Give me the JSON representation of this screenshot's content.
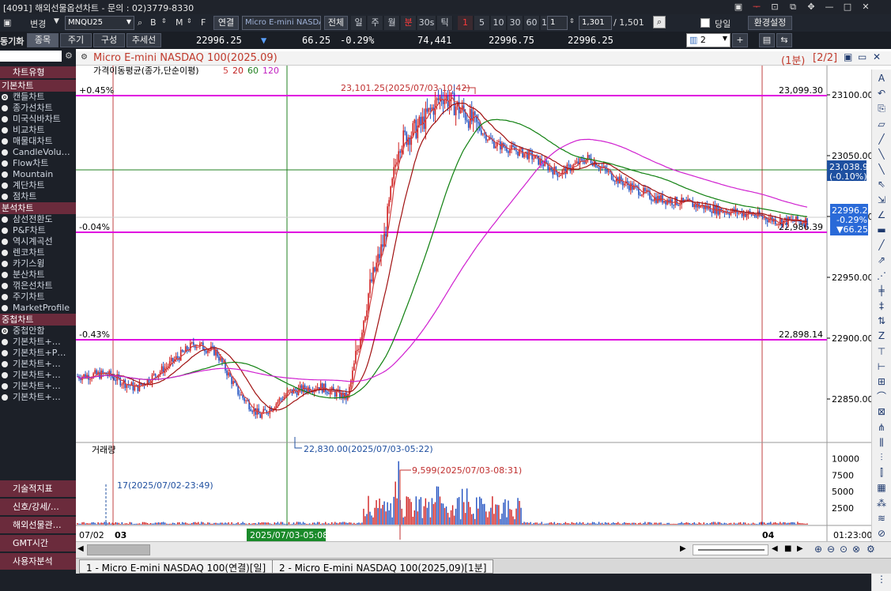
{
  "titlebar": {
    "title": "[4091] 해외선물옵션차트 - 문의 : 02)3779-8330",
    "buttons": [
      "▣",
      "ᅮ",
      "⊡",
      "⧉",
      "✥",
      "—",
      "□",
      "✕"
    ]
  },
  "toolbar1": {
    "change_label": "변경",
    "symbol_code": "MNQU25",
    "abc": [
      "B",
      "M",
      "F"
    ],
    "link_label": "연결",
    "symbol_name": "Micro E-mini NASDAQ",
    "all_label": "전체",
    "periods": [
      {
        "label": "일",
        "red": false
      },
      {
        "label": "주",
        "red": false
      },
      {
        "label": "월",
        "red": false
      },
      {
        "label": "분",
        "red": true
      },
      {
        "label": "30s",
        "red": false
      },
      {
        "label": "틱",
        "red": false
      },
      {
        "label": "1",
        "red": true
      },
      {
        "label": "5",
        "red": false
      },
      {
        "label": "10",
        "red": false
      },
      {
        "label": "30",
        "red": false
      },
      {
        "label": "60",
        "red": false
      },
      {
        "label": "120",
        "red": false
      }
    ],
    "interval_value": "1",
    "count_value": "1,301",
    "total_count": "/ 1,501",
    "same_day_label": "당일",
    "settings_label": "환경설정"
  },
  "toolbar2": {
    "left_label": "동기화",
    "tabs": [
      "종목",
      "주기",
      "구성",
      "추세선"
    ],
    "price": "22996.25",
    "change_arrow": "▼",
    "change": "66.25",
    "change_pct": "-0.29%",
    "volume": "74,441",
    "ask": "22996.75",
    "bid": "22996.25",
    "layout_count": "2"
  },
  "sidebar": {
    "top_header": "차트유형",
    "sections": [
      {
        "title": "기본차트",
        "items": [
          "캔들차트",
          "종가선차트",
          "미국식바차트",
          "비교차트",
          "매물대차트",
          "CandleVolu…",
          "Flow차트",
          "Mountain",
          "계단차트",
          "점차트"
        ],
        "selected": 0
      },
      {
        "title": "분석차트",
        "items": [
          "삼선전환도",
          "P&F차트",
          "역시계곡선",
          "렌코차트",
          "카기스윙",
          "분산차트",
          "꺾은선차트",
          "주기차트",
          "MarketProfile"
        ],
        "selected": -1
      },
      {
        "title": "중첩차트",
        "items": [
          "중첩안함",
          "기본차트+…",
          "기본차트+P…",
          "기본차트+…",
          "기본차트+…",
          "기본차트+…",
          "기본차트+…"
        ],
        "selected": 0
      }
    ],
    "footer": [
      "기술적지표",
      "신호/강세/…",
      "해외선물관…",
      "GMT시간",
      "사용자분석"
    ]
  },
  "chart": {
    "title": "Micro E-mini NASDAQ 100(2025.09)",
    "period_label": "(1분)",
    "page_label": "[2/2]",
    "legend_label": "가격이동평균(종가,단순이평)",
    "ma_periods": [
      {
        "label": "5",
        "color": "#d04040"
      },
      {
        "label": "20",
        "color": "#c02020"
      },
      {
        "label": "60",
        "color": "#208020"
      },
      {
        "label": "120",
        "color": "#c020c0"
      }
    ],
    "ref_lines": [
      {
        "pct": "+0.45%",
        "value": "23,099.30",
        "price": 23099.3
      },
      {
        "pct": "-0.04%",
        "value": "22,986.39",
        "price": 22986.39
      },
      {
        "pct": "-0.43%",
        "value": "22,898.14",
        "price": 22898.14
      }
    ],
    "high_annotation": "23,101.25(2025/07/03-10:42)",
    "low_annotation": "22,830.00(2025/07/03-05:22)",
    "price_axis": [
      "23100.00",
      "23050.00",
      "23000.00",
      "22950.00",
      "22900.00",
      "22850.00"
    ],
    "crosshair_price": "23,038.95",
    "crosshair_pct": "(-0.10%)",
    "current_price": "22996.25",
    "current_pct": "-0.29%",
    "current_change": "▼66.25",
    "volume_label": "거래량",
    "volume_max_annotation": "9,599(2025/07/03-08:31)",
    "volume_min_annotation": "17(2025/07/02-23:49)",
    "volume_axis": [
      "10000",
      "7500",
      "5000",
      "2500"
    ],
    "time_labels": [
      "07/02",
      "03",
      "04"
    ],
    "crosshair_time": "2025/07/03-05:08",
    "last_time": "01:23:00",
    "colors": {
      "ref_line": "#e000e0",
      "up": "#d02020",
      "down": "#2050c0",
      "ma5": "#d04040",
      "ma20": "#a01010",
      "ma60": "#108010",
      "ma120": "#d020d0",
      "title_red": "#c0392b",
      "sidebar_head": "#6b2b3c"
    }
  },
  "chart_data": {
    "type": "candlestick",
    "title": "Micro E-mini NASDAQ 100(2025.09)",
    "xlabel": "",
    "ylabel": "",
    "ylim": [
      22800,
      23120
    ],
    "x_session_marks": [
      "07/02",
      "03",
      "04"
    ],
    "price_path": [
      [
        0,
        22868
      ],
      [
        0.04,
        22870
      ],
      [
        0.08,
        22858
      ],
      [
        0.12,
        22875
      ],
      [
        0.16,
        22895
      ],
      [
        0.19,
        22888
      ],
      [
        0.22,
        22855
      ],
      [
        0.25,
        22835
      ],
      [
        0.29,
        22855
      ],
      [
        0.33,
        22860
      ],
      [
        0.37,
        22850
      ],
      [
        0.4,
        22940
      ],
      [
        0.42,
        22980
      ],
      [
        0.44,
        23060
      ],
      [
        0.47,
        23075
      ],
      [
        0.5,
        23100
      ],
      [
        0.53,
        23085
      ],
      [
        0.57,
        23060
      ],
      [
        0.62,
        23050
      ],
      [
        0.66,
        23035
      ],
      [
        0.7,
        23048
      ],
      [
        0.74,
        23030
      ],
      [
        0.79,
        23015
      ],
      [
        0.84,
        23010
      ],
      [
        0.88,
        23005
      ],
      [
        0.92,
        23002
      ],
      [
        0.96,
        22996
      ]
    ],
    "volume_max": 9599,
    "volume_min": 17
  }
}
